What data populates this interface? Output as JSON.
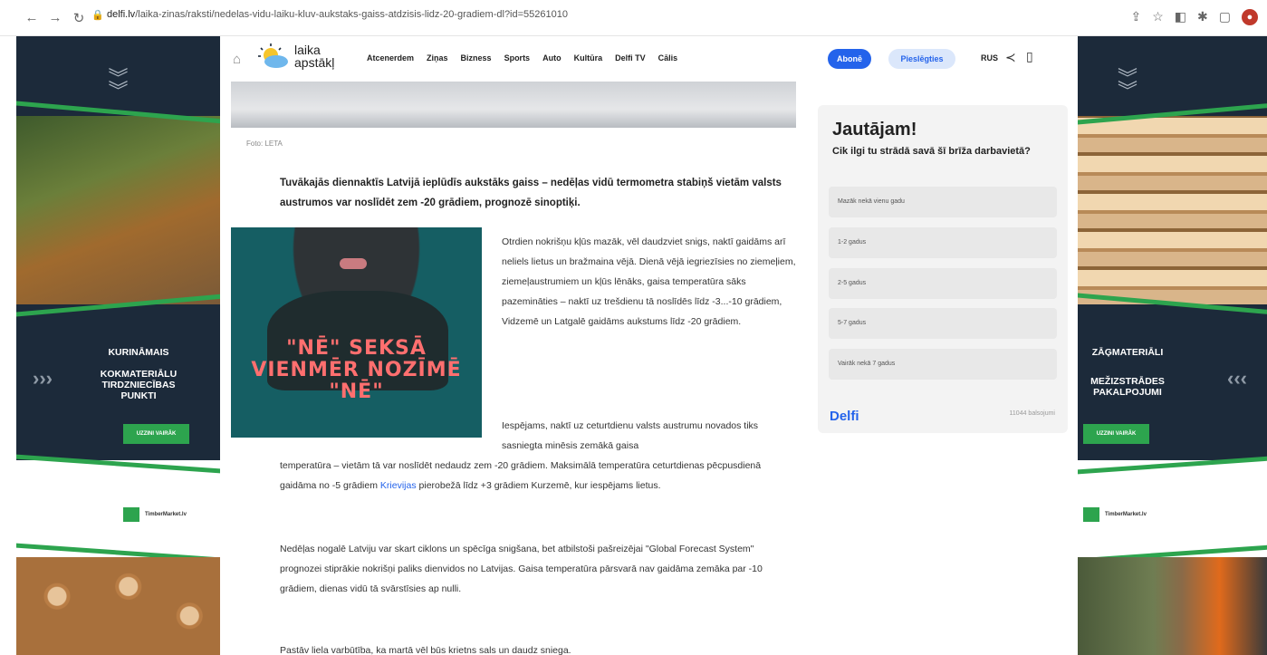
{
  "browser": {
    "url_domain": "delfi.lv",
    "url_path": "/laika-zinas/raksti/nedelas-vidu-laiku-kluv-aukstaks-gaiss-atdzisis-lidz-20-gradiem-dl?id=55261010",
    "icons": [
      "back-icon",
      "forward-icon",
      "reload-icon",
      "lock-icon",
      "share-icon",
      "star-icon",
      "extensions-icon",
      "puzzle-icon",
      "window-icon",
      "profile-icon"
    ]
  },
  "nav": {
    "brand_line1": "laika",
    "brand_line2": "apstākļ",
    "menu": [
      "Atcenerdem",
      "Ziņas",
      "Bizness",
      "Sports",
      "Auto",
      "Kultūra",
      "Delfi TV",
      "Cālis"
    ],
    "abone": "Abonē",
    "login": "Pieslēgties",
    "lang": "RUS"
  },
  "article": {
    "photo_caption": "Foto: LETA",
    "lead": "Tuvākajās diennaktīs Latvijā ieplūdīs aukstāks gaiss – nedēļas vidū termometra stabiņš vietām valsts austrumos var noslīdēt zem -20 grādiem, prognozē sinoptiķi.",
    "inline_ad_text": "\"NĒ\" SEKSĀ VIENMĒR NOZĪMĒ \"NĒ\"",
    "p1": "Otrdien nokrišņu kļūs mazāk, vēl daudzviet snigs, naktī gaidāms arī neliels lietus un bražmaina vējā. Dienā vējā iegriezīsies no ziemeļiem, ziemeļaustrumiem un kļūs lēnāks, gaisa temperatūra sāks pazemināties – naktī uz trešdienu tā noslīdēs līdz -3...-10 grādiem, Vidzemē un Latgalē gaidāms aukstums līdz -20 grādiem.",
    "p2a": "Iespējams, naktī uz ceturtdienu valsts austrumu novados tiks sasniegta minēsis zemākā gaisa",
    "p2b": "temperatūra – vietām tā var noslīdēt nedaudz zem -20 grādiem. Maksimālā temperatūra ceturtdienas pēcpusdienā gaidāma no -5 grādiem",
    "p2_link": "Krievijas",
    "p2c": "pierobežā līdz +3 grādiem Kurzemē, kur iespējams lietus.",
    "p3": "Nedēļas nogalē Latviju var skart ciklons un spēcīga snigšana, bet atbilstoši pašreizējai \"Global Forecast System\" prognozei stiprākie nokrišņi paliks dienvidos no Latvijas. Gaisa temperatūra pārsvarā nav gaidāma zemāka par -10 grādiem, dienas vidū tā svārstīsies ap nulli.",
    "p4": "Pastāv liela varbūtība, ka martā vēl būs krietns sals un daudz sniega."
  },
  "poll": {
    "title": "Jautājam!",
    "question": "Cik ilgi tu strādā savā šī brīža darbavietā?",
    "options": [
      "Mazāk nekā vienu gadu",
      "1-2 gadus",
      "2-5 gadus",
      "5-7 gadus",
      "Vairāk nekā 7 gadus"
    ],
    "brand": "Delfi",
    "votes": "11044 balsojumi"
  },
  "ads": {
    "left": {
      "line1": "KURINĀMAIS",
      "line2": "KOKMATERIĀLU",
      "line3": "TIRDZNIECĪBAS",
      "line4": "PUNKTI",
      "button": "UZZINI VAIRĀK",
      "brand": "TimberMarket.lv"
    },
    "right": {
      "line1": "ZĀĢMATERIĀLI",
      "line2": "MEŽIZSTRĀDES",
      "line3": "PAKALPOJUMI",
      "button": "UZZINI VAIRĀK",
      "brand": "TimberMarket.lv"
    }
  },
  "colors": {
    "accent": "#2463eb",
    "ad_dark": "#1c2a3a",
    "ad_green": "#2da44e"
  }
}
